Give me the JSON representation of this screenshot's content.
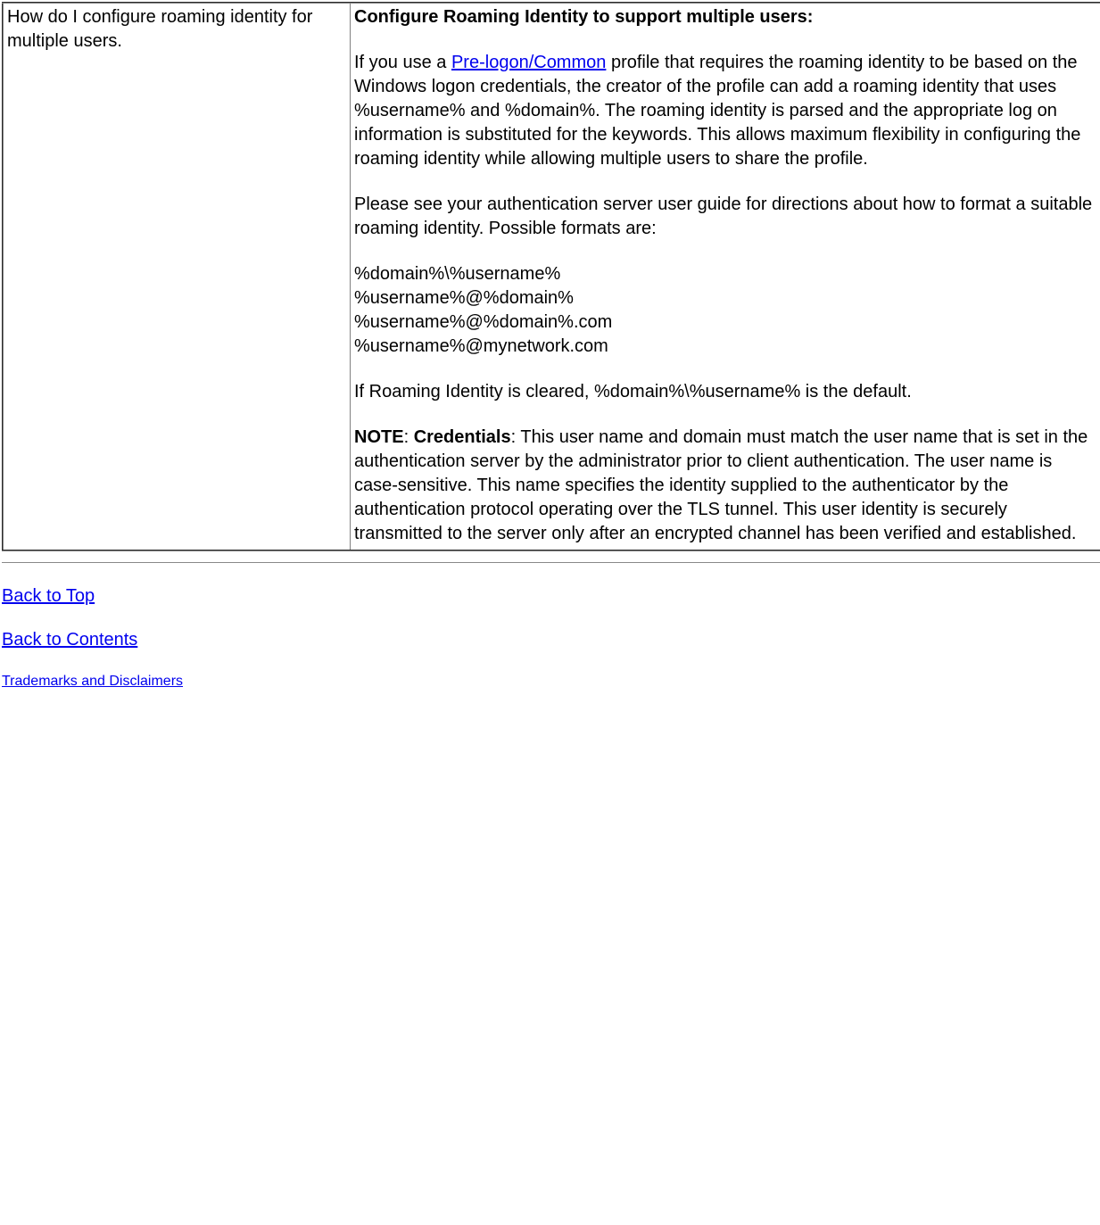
{
  "table": {
    "left": "How do I configure roaming identity for multiple users.",
    "right": {
      "heading": "Configure Roaming Identity to support multiple users:",
      "p1a": "If you use a ",
      "link1": "Pre-logon/Common",
      "p1b": " profile that requires the roaming identity to be based on the Windows logon credentials, the creator of the profile can add a roaming identity that uses %username% and %domain%. The roaming identity is parsed and the appropriate ​log on information is substituted for the keywords. This allows maximum flexibility in configuring the roaming identity while allowing multiple users to share the profile.",
      "p2": "Please see your authentication server user guide for directions about how to format a suitable roaming identity. Possible formats are:",
      "f1": "%domain%\\%username%",
      "f2": "%username%@%domain%",
      "f3": "%username%@%domain%.com",
      "f4": "%username%@mynetwork.com",
      "p3": "If Roaming Identity is cleared, %domain%\\%username% is the default.",
      "note_label": "NOTE",
      "note_sep": ": ",
      "cred_label": "Credentials",
      "note_text": ": This user name and domain must match the user name that is set in the authentication server by the administrator prior to client authentication. The user name is case-sensitive. This name specifies the identity supplied to the authenticator by the authentication protocol operating over the TLS tunnel. This user identity is securely transmitted to the server only after an encrypted channel has been verified and established."
    }
  },
  "links": {
    "back_top": "Back to Top",
    "back_contents": "Back to Contents",
    "trademarks": "Trademarks and Disclaimers"
  }
}
